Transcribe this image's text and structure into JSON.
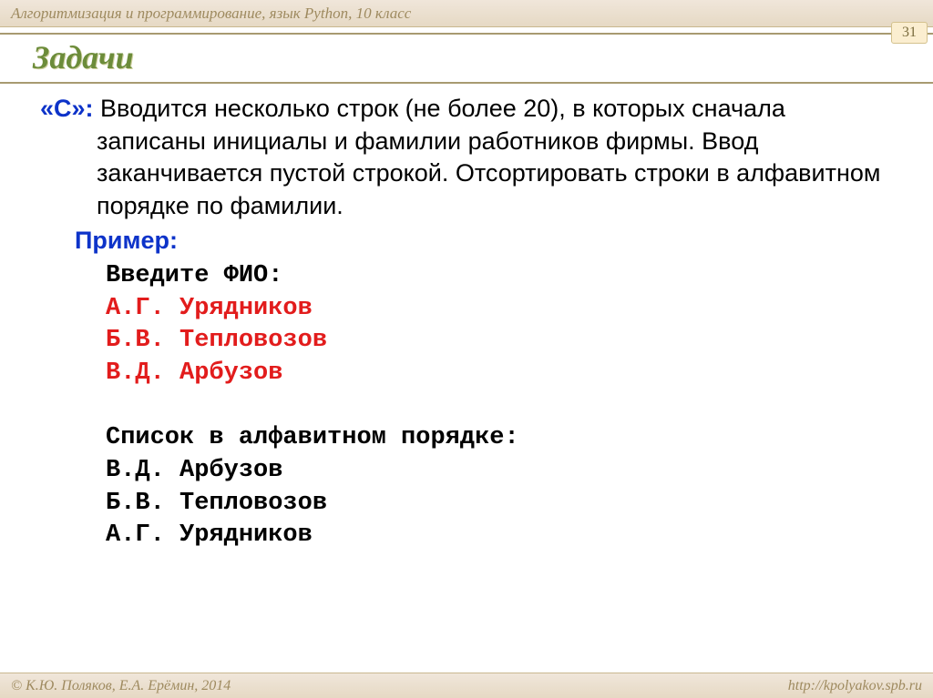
{
  "header": {
    "breadcrumb": "Алгоритмизация и программирование, язык Python, 10 класс",
    "page_number": "31"
  },
  "title": "Задачи",
  "task": {
    "prefix": "«C»:",
    "text": " Вводится несколько строк (не более 20), в которых сначала записаны инициалы и фамилии работников фирмы. Ввод заканчивается пустой строкой. Отсортировать  строки в алфавитном порядке по фамилии."
  },
  "example": {
    "label": "Пример:",
    "prompt": "Введите ФИО:",
    "input_lines": [
      "А.Г. Урядников",
      "Б.В. Тепловозов",
      "В.Д. Арбузов"
    ],
    "output_header": "Список в алфавитном порядке:",
    "output_lines": [
      "В.Д. Арбузов",
      "Б.В. Тепловозов",
      "А.Г. Урядников"
    ]
  },
  "footer": {
    "copyright": "© К.Ю. Поляков, Е.А. Ерёмин, 2014",
    "url": "http://kpolyakov.spb.ru"
  }
}
